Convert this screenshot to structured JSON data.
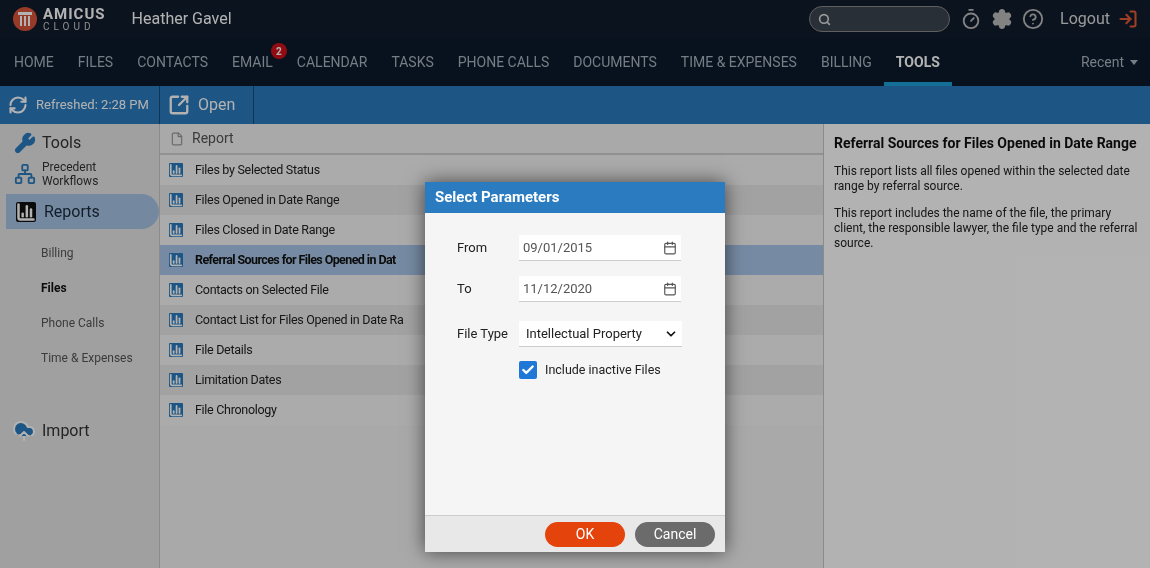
{
  "header": {
    "logo": {
      "main": "AMICUS",
      "sub": "CLOUD"
    },
    "user": "Heather Gavel",
    "logout": "Logout"
  },
  "nav": {
    "tabs": [
      {
        "label": "HOME",
        "selected": false
      },
      {
        "label": "FILES",
        "selected": false
      },
      {
        "label": "CONTACTS",
        "selected": false
      },
      {
        "label": "EMAIL",
        "selected": false,
        "badge": "2"
      },
      {
        "label": "CALENDAR",
        "selected": false
      },
      {
        "label": "TASKS",
        "selected": false
      },
      {
        "label": "PHONE CALLS",
        "selected": false
      },
      {
        "label": "DOCUMENTS",
        "selected": false
      },
      {
        "label": "TIME & EXPENSES",
        "selected": false
      },
      {
        "label": "BILLING",
        "selected": false
      },
      {
        "label": "TOOLS",
        "selected": true
      }
    ],
    "recent": "Recent"
  },
  "toolbar": {
    "refreshed": "Refreshed: 2:28 PM",
    "open": "Open"
  },
  "sidebar": {
    "title": "Tools",
    "workflows": "Precedent Workflows",
    "reports": {
      "label": "Reports",
      "selected": true
    },
    "subitems": [
      {
        "label": "Billing",
        "selected": false
      },
      {
        "label": "Files",
        "selected": true
      },
      {
        "label": "Phone Calls",
        "selected": false
      },
      {
        "label": "Time & Expenses",
        "selected": false
      }
    ],
    "import": "Import"
  },
  "reports": {
    "header": "Report",
    "rows": [
      {
        "label": "Files by Selected Status",
        "selected": false
      },
      {
        "label": "Files Opened in Date Range",
        "selected": false
      },
      {
        "label": "Files Closed in Date Range",
        "selected": false
      },
      {
        "label": "Referral Sources for Files Opened in Dat",
        "selected": true
      },
      {
        "label": "Contacts on Selected File",
        "selected": false
      },
      {
        "label": "Contact List for Files Opened in Date Ra",
        "selected": false
      },
      {
        "label": "File Details",
        "selected": false
      },
      {
        "label": "Limitation Dates",
        "selected": false
      },
      {
        "label": "File Chronology",
        "selected": false
      }
    ]
  },
  "details": {
    "title": "Referral Sources for Files Opened in Date Range",
    "paragraphs": [
      "This report lists all files opened within the selected date range by referral source.",
      "This report includes the name of the file, the primary client, the responsible lawyer, the file type and the referral source."
    ]
  },
  "dialog": {
    "title": "Select Parameters",
    "from": {
      "label": "From",
      "value": "09/01/2015"
    },
    "to": {
      "label": "To",
      "value": "11/12/2020"
    },
    "file_type": {
      "label": "File Type",
      "value": "Intellectual Property"
    },
    "include_inactive": {
      "label": "Include inactive Files",
      "checked": true
    },
    "buttons": {
      "ok": "OK",
      "cancel": "Cancel"
    }
  }
}
